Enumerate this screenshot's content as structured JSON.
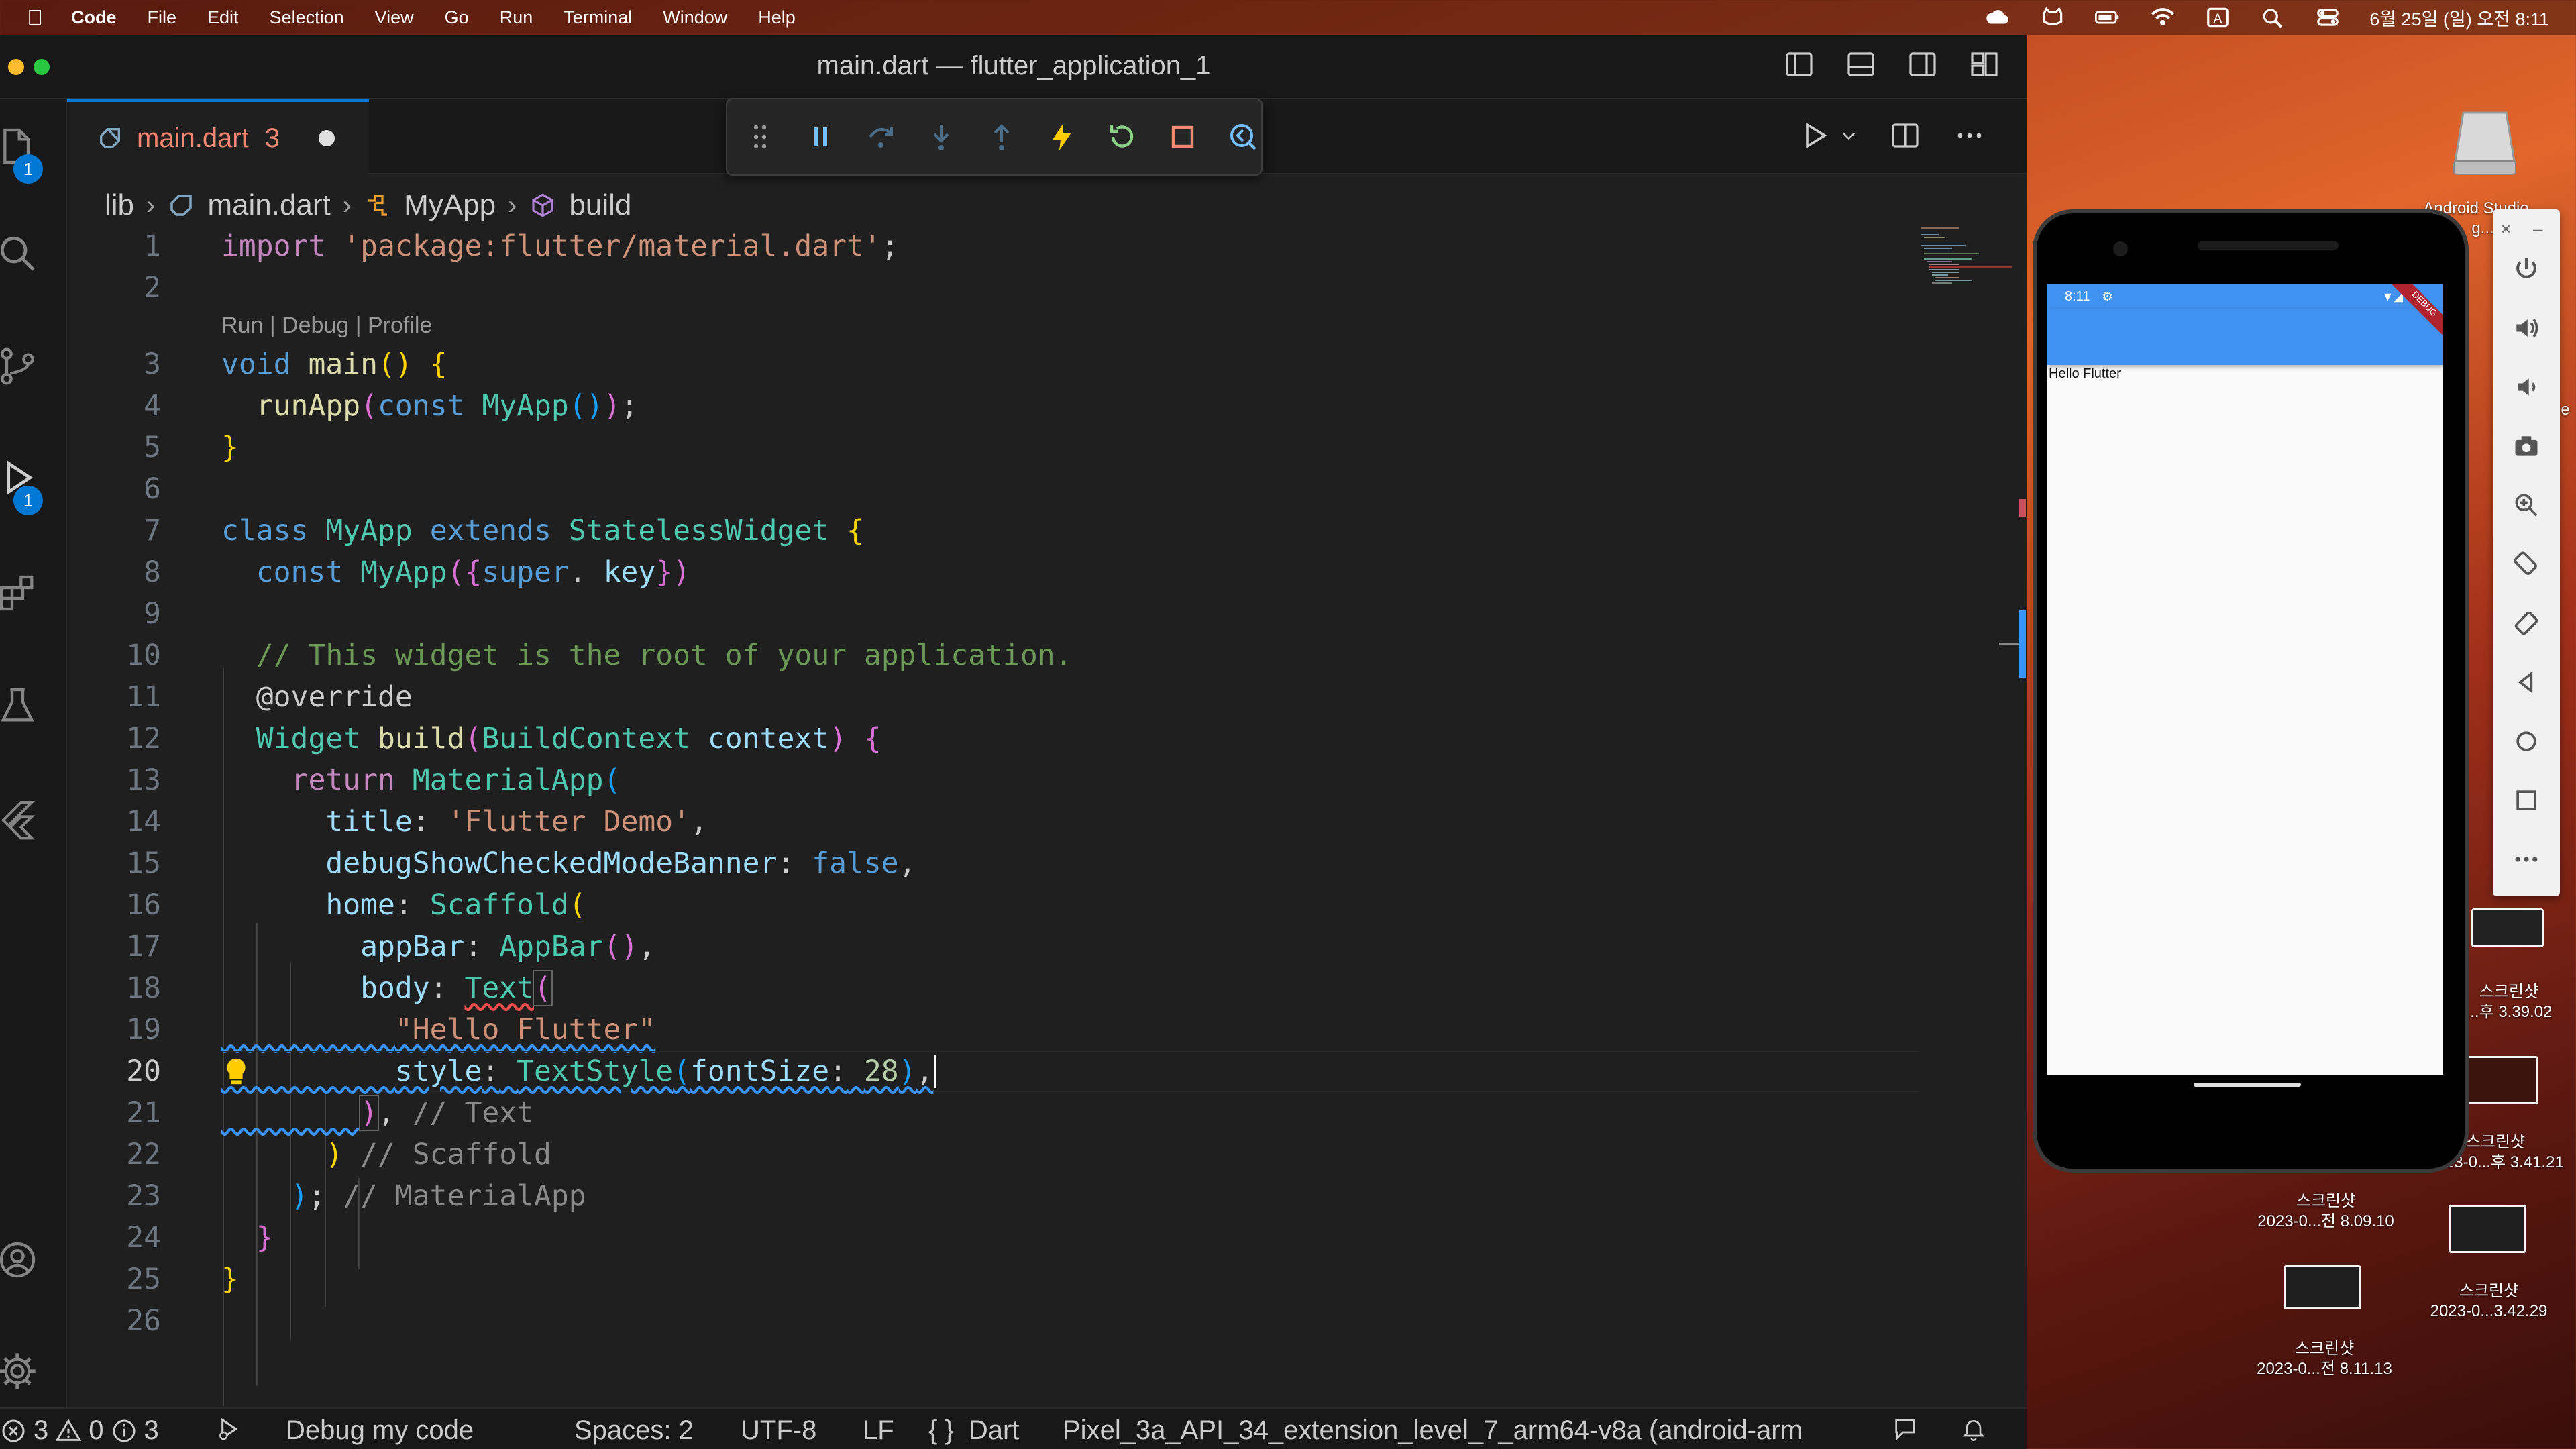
{
  "menubar": {
    "app_name": "Code",
    "items": [
      "File",
      "Edit",
      "Selection",
      "View",
      "Go",
      "Run",
      "Terminal",
      "Window",
      "Help"
    ],
    "clock": "6월 25일 (일) 오전 8:11",
    "input_indicator": "A"
  },
  "window": {
    "title": "main.dart — flutter_application_1"
  },
  "tab": {
    "name": "main.dart",
    "problems": "3"
  },
  "activity": {
    "explorer_badge": "1",
    "debug_badge": "1"
  },
  "breadcrumb": {
    "folder": "lib",
    "file": "main.dart",
    "class": "MyApp",
    "method": "build"
  },
  "codelens": "Run | Debug | Profile",
  "line_numbers": [
    "1",
    "2",
    "3",
    "4",
    "5",
    "6",
    "7",
    "8",
    "9",
    "10",
    "11",
    "12",
    "13",
    "14",
    "15",
    "16",
    "17",
    "18",
    "19",
    "20",
    "21",
    "22",
    "23",
    "24",
    "25",
    "26"
  ],
  "code": {
    "l1_kw": "import",
    "l1_str": "'package:flutter/material.dart'",
    "l1_end": ";",
    "l3_kw": "void",
    "l3_fn": "main",
    "l3_paren": "()",
    "l3_brace": "{",
    "l4_fn": "runApp",
    "l4_open": "(",
    "l4_kw": "const",
    "l4_cls": "MyApp",
    "l4_parens": "()",
    "l4_close": ")",
    "l4_end": ";",
    "l5_brace": "}",
    "l7_kw": "class",
    "l7_cls": "MyApp",
    "l7_ext": "extends",
    "l7_base": "StatelessWidget",
    "l7_brace": "{",
    "l8_kw": "const",
    "l8_cls": "MyApp",
    "l8_open": "({",
    "l8_super": "super",
    "l8_dot": ".",
    "l8_key": "key",
    "l8_close": "})",
    "l10_comment": "// This widget is the root of your application.",
    "l11_annotation": "@override",
    "l12_ret": "Widget",
    "l12_fn": "build",
    "l12_open": "(",
    "l12_type": "BuildContext",
    "l12_param": "context",
    "l12_close": ")",
    "l12_brace": "{",
    "l13_kw": "return",
    "l13_cls": "MaterialApp",
    "l13_open": "(",
    "l14_prop": "title",
    "l14_colon": ":",
    "l14_str": "'Flutter Demo'",
    "l14_comma": ",",
    "l15_prop": "debugShowCheckedModeBanner",
    "l15_colon": ":",
    "l15_val": "false",
    "l15_comma": ",",
    "l16_prop": "home",
    "l16_colon": ":",
    "l16_cls": "Scaffold",
    "l16_open": "(",
    "l17_prop": "appBar",
    "l17_colon": ":",
    "l17_cls": "AppBar",
    "l17_parens": "()",
    "l17_comma": ",",
    "l18_prop": "body",
    "l18_colon": ":",
    "l18_cls": "Text",
    "l18_open": "(",
    "l19_str": "\"Hello Flutter\"",
    "l20_prop": "style",
    "l20_colon": ":",
    "l20_cls": "TextStyle",
    "l20_open": "(",
    "l20_arg": "fontSize",
    "l20_argcolon": ":",
    "l20_num": "28",
    "l20_close": ")",
    "l20_comma": ",",
    "l21_close": ")",
    "l21_comma": ",",
    "l21_comment": "// Text",
    "l22_close": ")",
    "l22_comment": "// Scaffold",
    "l23_close": ")",
    "l23_end": ";",
    "l23_comment": "// MaterialApp",
    "l24_brace": "}",
    "l25_brace": "}"
  },
  "statusbar": {
    "errors": "3",
    "warnings": "0",
    "infos": "3",
    "debug_label": "Debug my code",
    "spaces": "Spaces: 2",
    "encoding": "UTF-8",
    "eol": "LF",
    "lang_braces": "{ }",
    "language": "Dart",
    "device": "Pixel_3a_API_34_extension_level_7_arm64-v8a (android-arm"
  },
  "emulator": {
    "status_time": "8:11",
    "body_text": "Hello Flutter",
    "debug_banner": "DEBUG"
  },
  "desktop": {
    "disk_label": "Android Studio...",
    "disk_label_2": "g...",
    "files": [
      {
        "line1": "스크린샷",
        "line2": "...후 3.39.02"
      },
      {
        "line1": "스크린샷",
        "line2": "2023-0...후 3.41.21"
      },
      {
        "line1": "스크린샷",
        "line2": "2023-0...전 8.09.10"
      },
      {
        "line1": "스크린샷",
        "line2": "2023-0...3.42.29"
      },
      {
        "line1": "스크린샷",
        "line2": "2023-0...전 8.11.13"
      }
    ],
    "side_e": "e"
  },
  "colors": {
    "accent": "#0078d4",
    "error": "#f14c4c",
    "flutter_blue": "#4192f0"
  }
}
